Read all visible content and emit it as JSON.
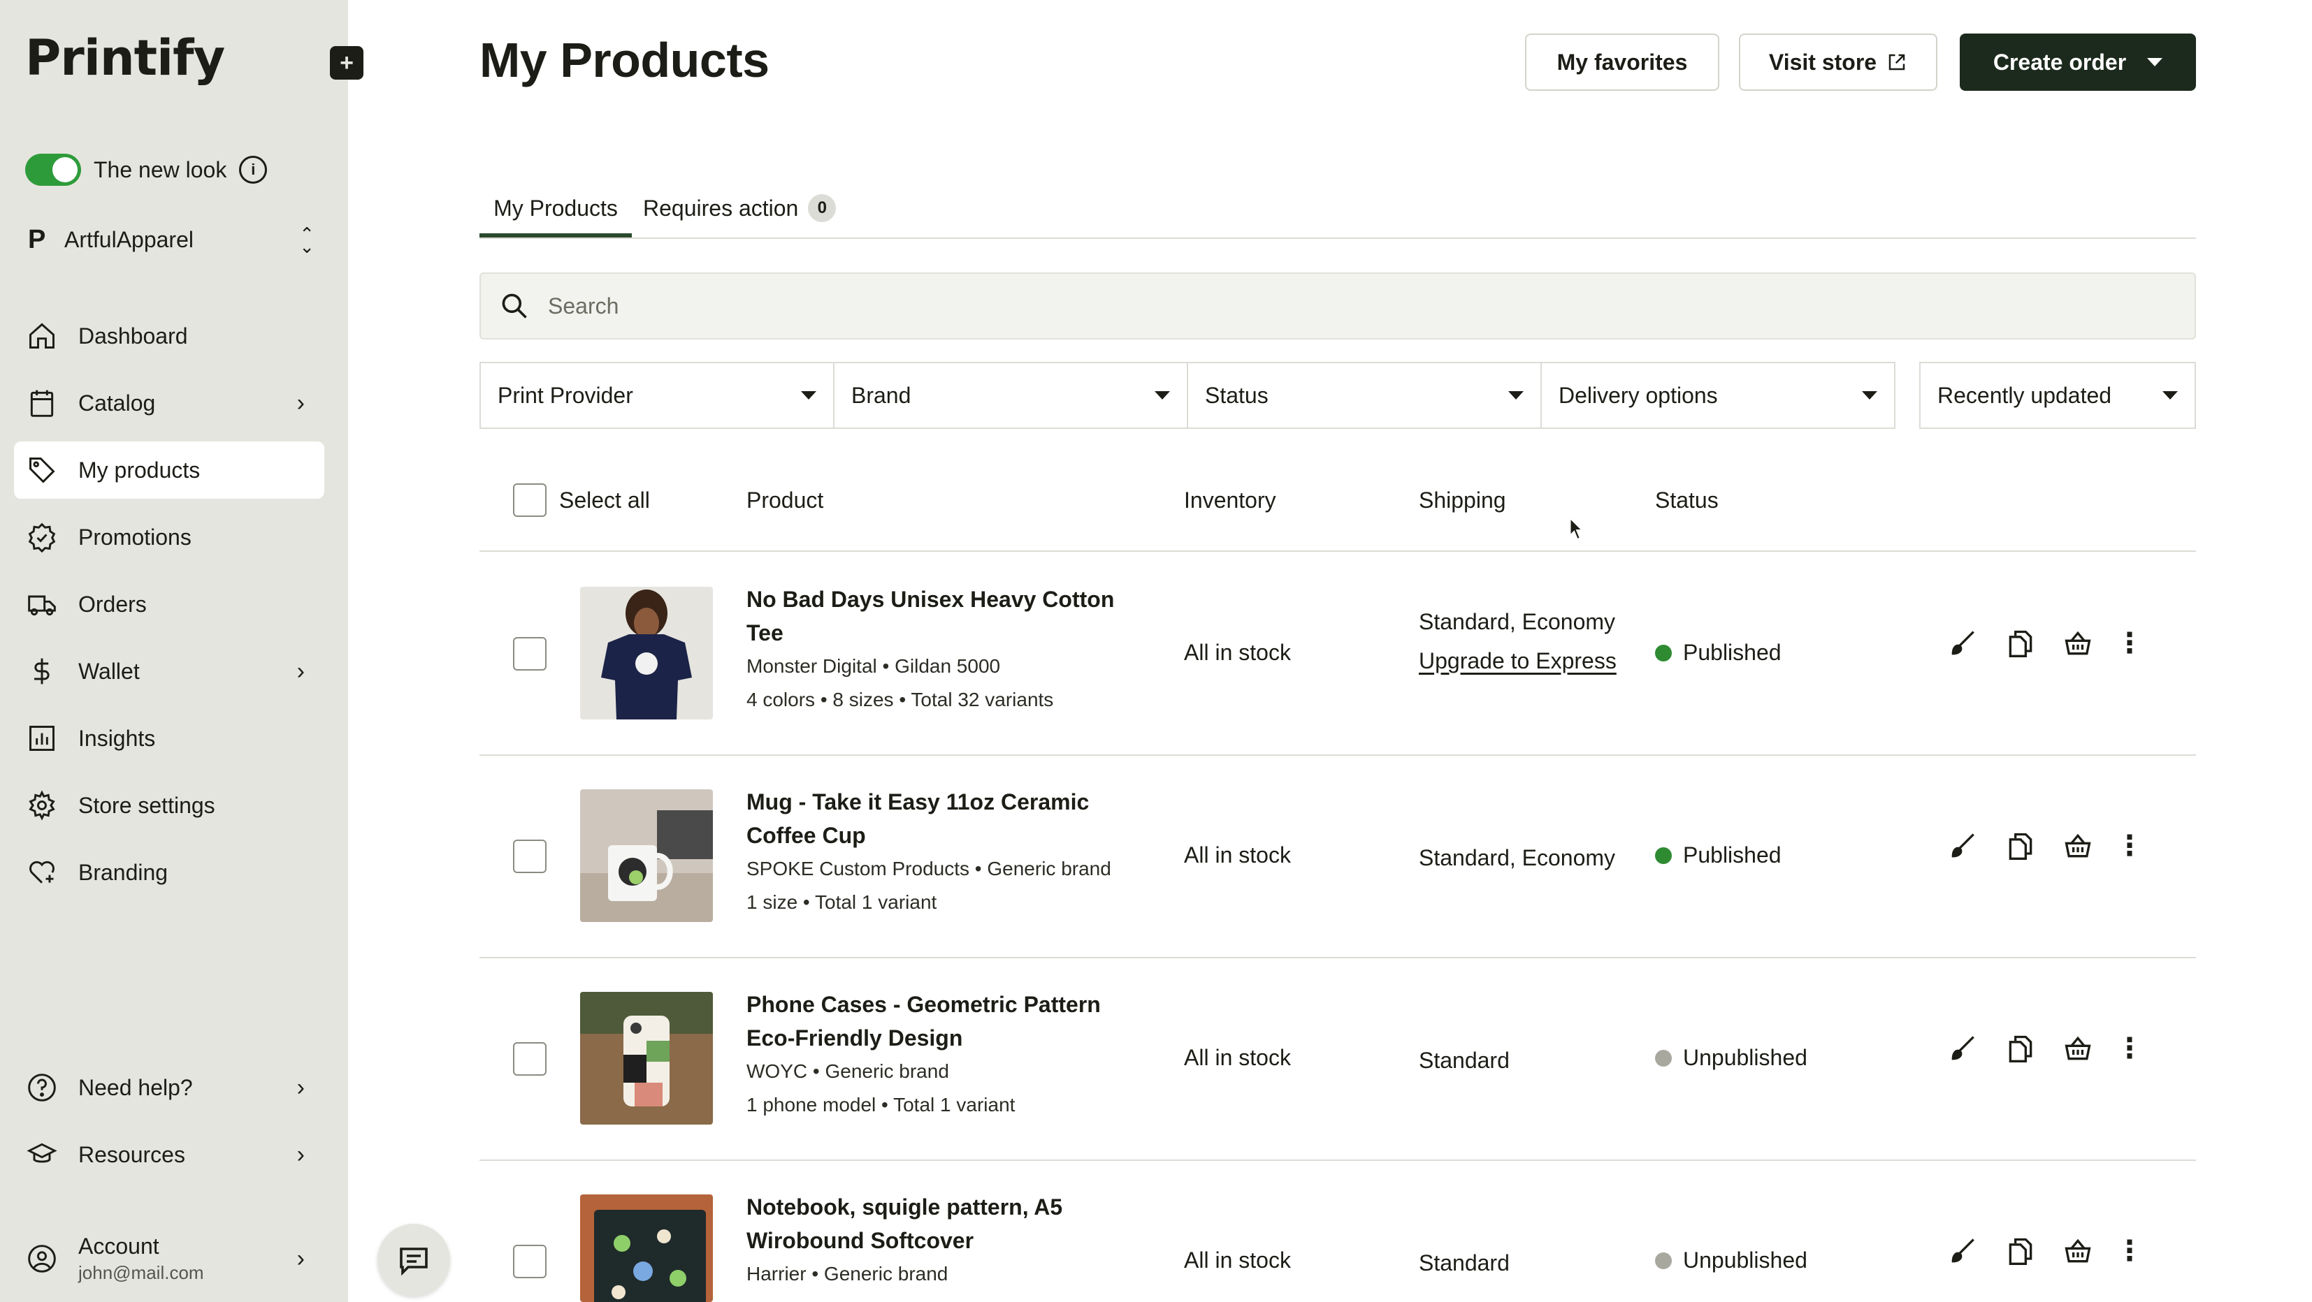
{
  "brand": {
    "logo_text": "Printify"
  },
  "sidebar": {
    "toggle_label": "The new look",
    "store_name": "ArtfulApparel",
    "items": [
      {
        "label": "Dashboard"
      },
      {
        "label": "Catalog"
      },
      {
        "label": "My products"
      },
      {
        "label": "Promotions"
      },
      {
        "label": "Orders"
      },
      {
        "label": "Wallet"
      },
      {
        "label": "Insights"
      },
      {
        "label": "Store settings"
      },
      {
        "label": "Branding"
      }
    ],
    "bottom_items": [
      {
        "label": "Need help?"
      },
      {
        "label": "Resources"
      }
    ],
    "account": {
      "title": "Account",
      "email": "john@mail.com"
    }
  },
  "header": {
    "title": "My Products",
    "favorites_label": "My favorites",
    "visit_store_label": "Visit store",
    "create_order_label": "Create order"
  },
  "tabs": [
    {
      "label": "My Products"
    },
    {
      "label": "Requires action",
      "count": "0"
    }
  ],
  "search": {
    "placeholder": "Search"
  },
  "filters": [
    {
      "label": "Print Provider"
    },
    {
      "label": "Brand"
    },
    {
      "label": "Status"
    },
    {
      "label": "Delivery options"
    }
  ],
  "sort": {
    "label": "Recently updated"
  },
  "table": {
    "select_all": "Select all",
    "columns": {
      "product": "Product",
      "inventory": "Inventory",
      "shipping": "Shipping",
      "status": "Status"
    },
    "rows": [
      {
        "name": "No Bad Days Unisex Heavy Cotton Tee",
        "provider": "Monster Digital • Gildan 5000",
        "variants": "4 colors • 8 sizes • Total 32 variants",
        "inventory": "All in stock",
        "shipping": "Standard, Economy",
        "shipping_link": "Upgrade to Express",
        "status": "Published",
        "status_color": "#2e8b32"
      },
      {
        "name": "Mug - Take it Easy 11oz Ceramic Coffee Cup",
        "provider": "SPOKE Custom Products • Generic brand",
        "variants": "1 size • Total 1 variant",
        "inventory": "All in stock",
        "shipping": "Standard, Economy",
        "status": "Published",
        "status_color": "#2e8b32"
      },
      {
        "name": "Phone Cases - Geometric Pattern Eco-Friendly Design",
        "provider": "WOYC • Generic brand",
        "variants": "1 phone model • Total 1 variant",
        "inventory": "All in stock",
        "shipping": "Standard",
        "status": "Unpublished",
        "status_color": "#a8a89f"
      },
      {
        "name": "Notebook, squigle pattern, A5 Wirobound Softcover",
        "provider": "Harrier • Generic brand",
        "inventory": "All in stock",
        "shipping": "Standard",
        "status": "Unpublished",
        "status_color": "#a8a89f"
      }
    ]
  },
  "colors": {
    "sidebar_bg": "#e5e5df",
    "accent_dark": "#1c2a1d",
    "toggle_on": "#2e9b3a"
  }
}
